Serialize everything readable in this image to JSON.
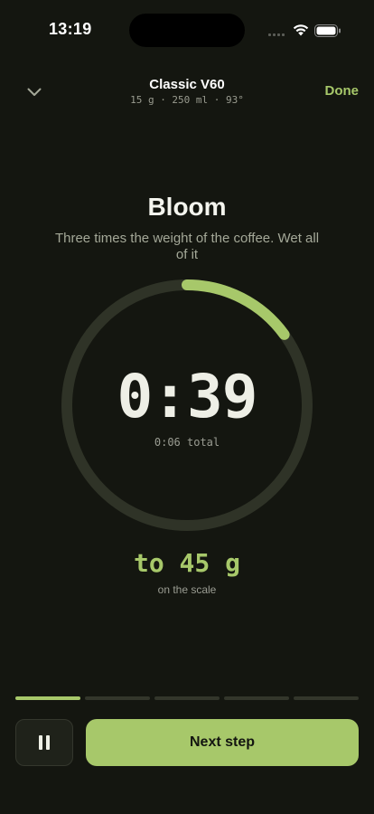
{
  "status_bar": {
    "time": "13:19"
  },
  "header": {
    "title": "Classic V60",
    "meta": "15 g · 250 ml · 93°",
    "done_label": "Done"
  },
  "step": {
    "title": "Bloom",
    "description": "Three times the weight of the coffee. Wet all of it"
  },
  "timer": {
    "elapsed": "0:39",
    "total": "0:06 total",
    "ring_progress": 0.15
  },
  "target": {
    "weight": "to 45 g",
    "caption": "on the scale"
  },
  "steps_progress": {
    "total": 5,
    "current": 1
  },
  "controls": {
    "next_label": "Next step",
    "pause_icon": "pause-icon"
  },
  "colors": {
    "accent": "#a7c86a",
    "background": "#141610",
    "ring_track": "#2f3327"
  }
}
